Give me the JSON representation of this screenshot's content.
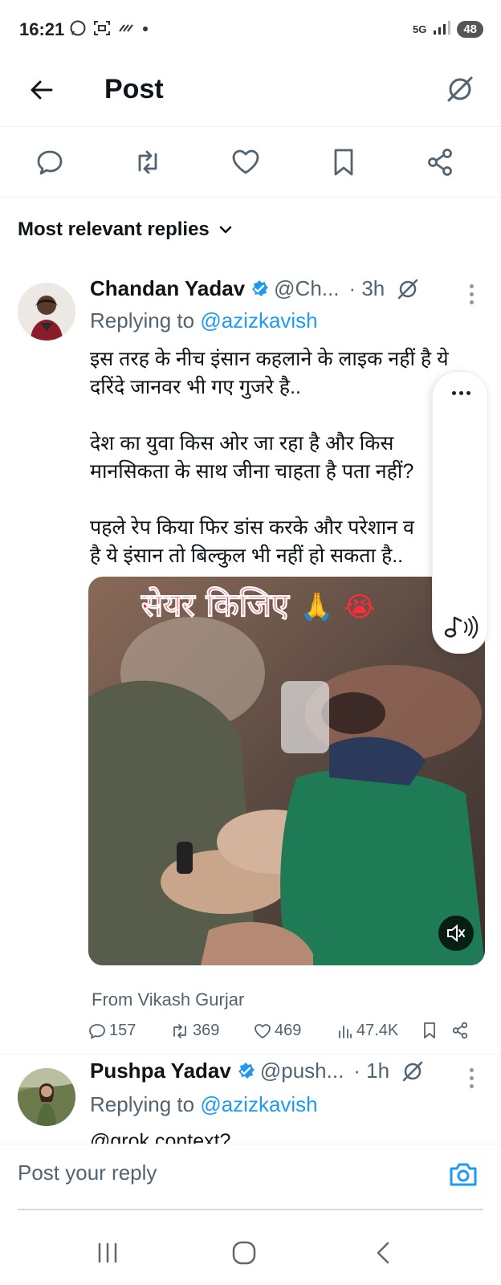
{
  "status_bar": {
    "time": "16:21",
    "network": "5G",
    "battery": "48"
  },
  "header": {
    "title": "Post"
  },
  "sort": {
    "label": "Most relevant replies"
  },
  "replies": [
    {
      "name": "Chandan Yadav",
      "handle": "@Ch...",
      "time": "· 3h",
      "replying_prefix": "Replying to",
      "replying_to": "@azizkavish",
      "text": "इस तरह के नीच इंसान कहलाने के लाइक नहीं है ये\nदरिंदे जानवर भी गए गुजरे है..\n\nदेश का युवा किस ओर जा रहा है और किस\nमानसिकता के साथ जीना चाहता है पता नहीं?\n\nपहले रेप किया फिर डांस करके और परेशान व\nहै ये इंसान तो बिल्कुल भी नहीं हो सकता है..",
      "media_caption": "सेयर किजिए",
      "media_caption_emoji": "🙏 😭",
      "from": "From Vikash Gurjar",
      "metrics": {
        "replies": "157",
        "reposts": "369",
        "likes": "469",
        "views": "47.4K"
      }
    },
    {
      "name": "Pushpa Yadav",
      "handle": "@push...",
      "time": "· 1h",
      "replying_prefix": "Replying to",
      "replying_to": "@azizkavish",
      "text": "@grok context?"
    }
  ],
  "composer": {
    "placeholder": "Post your reply"
  },
  "colors": {
    "accent": "#1d9bf0",
    "text": "#0f1419",
    "muted": "#536471"
  }
}
